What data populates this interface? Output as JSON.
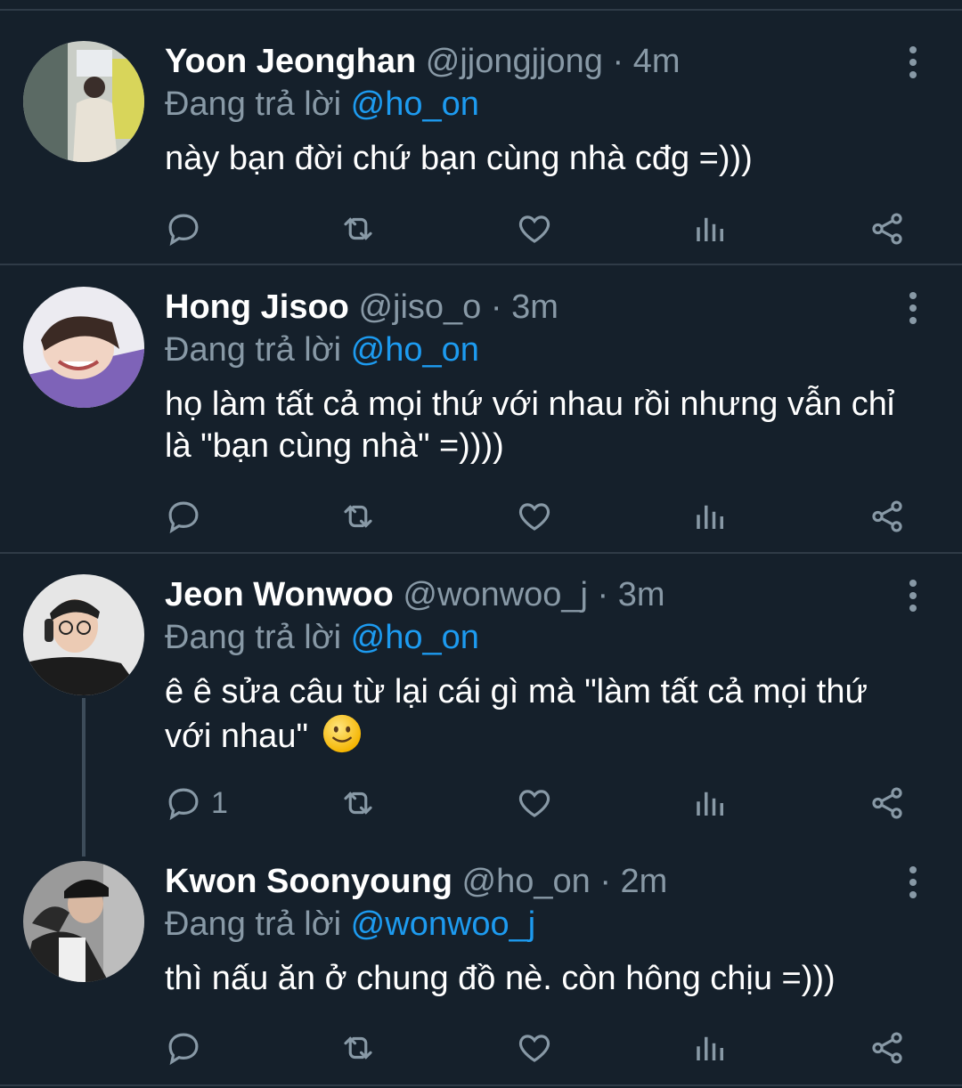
{
  "reply_prefix": "Đang trả lời",
  "colors": {
    "background": "#15202b",
    "mention": "#1d9bf0",
    "muted": "#8899a6",
    "emoji": "#ffcc33"
  },
  "tweets": [
    {
      "name": "Yoon Jeonghan",
      "handle": "@jjongjjong",
      "separator": "·",
      "time": "4m",
      "reply_to": "@ho_on",
      "text": "này bạn đời chứ bạn cùng nhà cđg =)))",
      "reply_count": ""
    },
    {
      "name": "Hong Jisoo",
      "handle": "@jiso_o",
      "separator": "·",
      "time": "3m",
      "reply_to": "@ho_on",
      "text": "họ làm tất cả mọi thứ với nhau rồi nhưng vẫn chỉ là \"bạn cùng nhà\" =))))",
      "reply_count": ""
    },
    {
      "name": "Jeon Wonwoo",
      "handle": "@wonwoo_j",
      "separator": "·",
      "time": "3m",
      "reply_to": "@ho_on",
      "text": "ê ê sửa câu từ lại cái gì mà \"làm tất cả mọi thứ với nhau\"",
      "emoji": "slightly-smiling-face",
      "reply_count": "1"
    },
    {
      "name": "Kwon Soonyoung",
      "handle": "@ho_on",
      "separator": "·",
      "time": "2m",
      "reply_to": "@wonwoo_j",
      "text": "thì nấu ăn ở chung đồ nè. còn hông chịu =)))",
      "reply_count": ""
    }
  ],
  "icons": [
    "reply-icon",
    "retweet-icon",
    "like-icon",
    "analytics-icon",
    "share-icon",
    "more-icon"
  ]
}
